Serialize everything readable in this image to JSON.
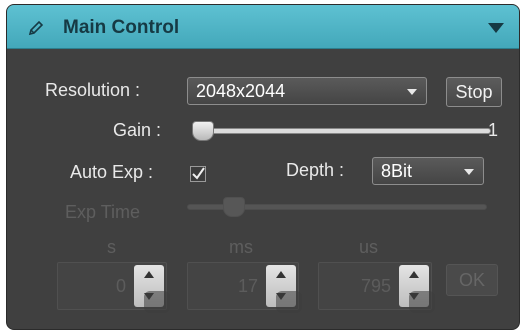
{
  "panel": {
    "title": "Main Control",
    "title_bar_color": "#4fb6c8",
    "background_color": "#404040"
  },
  "resolution": {
    "label": "Resolution :",
    "value": "2048x2044"
  },
  "stop_button": {
    "label": "Stop"
  },
  "gain": {
    "label": "Gain :",
    "value": "1",
    "slider_fraction": 0
  },
  "auto_exp": {
    "label": "Auto Exp :",
    "checked": true
  },
  "depth": {
    "label": "Depth :",
    "value": "8Bit"
  },
  "exp_time": {
    "label": "Exp Time",
    "slider_fraction": 0.1,
    "enabled": false,
    "units": {
      "s": "s",
      "ms": "ms",
      "us": "us"
    },
    "values": {
      "s": "0",
      "ms": "17",
      "us": "795"
    }
  },
  "ok_button": {
    "label": "OK",
    "enabled": false
  },
  "icons": {
    "title": "pencil-icon",
    "collapse": "triangle-down-icon",
    "combo": "chevron-down-icon",
    "check": "checkmark-icon",
    "spin_up": "arrow-up-icon",
    "spin_down": "arrow-down-icon"
  }
}
